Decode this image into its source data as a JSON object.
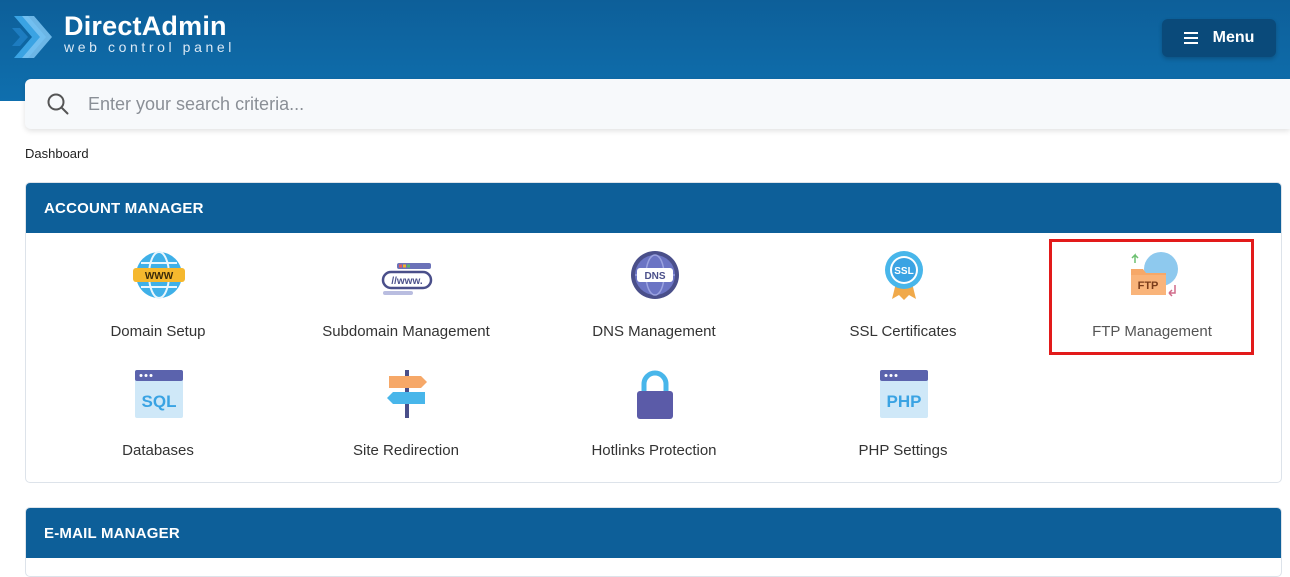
{
  "brand": {
    "title": "DirectAdmin",
    "subtitle": "web control panel"
  },
  "header": {
    "menu_label": "Menu"
  },
  "search": {
    "placeholder": "Enter your search criteria..."
  },
  "breadcrumb": "Dashboard",
  "account_manager": {
    "title": "ACCOUNT MANAGER",
    "items": [
      {
        "label": "Domain Setup",
        "icon": "www-globe-icon"
      },
      {
        "label": "Subdomain Management",
        "icon": "subdomain-icon"
      },
      {
        "label": "DNS Management",
        "icon": "dns-icon"
      },
      {
        "label": "SSL Certificates",
        "icon": "ssl-badge-icon"
      },
      {
        "label": "FTP Management",
        "icon": "ftp-folder-icon"
      },
      {
        "label": "Databases",
        "icon": "sql-icon"
      },
      {
        "label": "Site Redirection",
        "icon": "signpost-icon"
      },
      {
        "label": "Hotlinks Protection",
        "icon": "padlock-icon"
      },
      {
        "label": "PHP Settings",
        "icon": "php-icon"
      }
    ]
  },
  "email_manager": {
    "title": "E-MAIL MANAGER"
  },
  "colors": {
    "header_blue": "#0d5f99",
    "menu_button": "#0a4a7a",
    "highlight": "#e21a1a"
  }
}
